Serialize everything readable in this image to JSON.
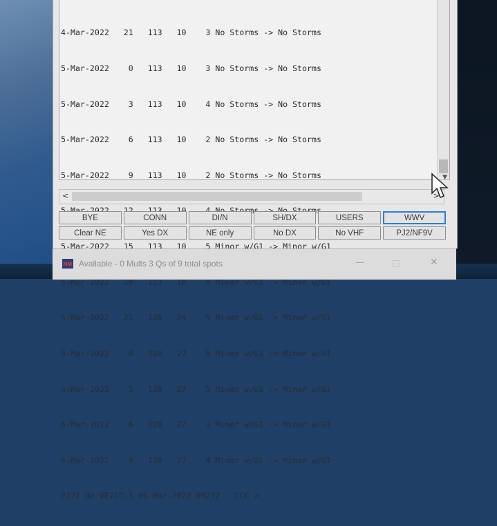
{
  "terminal": {
    "lines": [
      "4-Mar-2022   21   113   10    3 No Storms -> No Storms",
      "5-Mar-2022    0   113   10    3 No Storms -> No Storms",
      "5-Mar-2022    3   113   10    4 No Storms -> No Storms",
      "5-Mar-2022    6   113   10    2 No Storms -> No Storms",
      "5-Mar-2022    9   113   10    2 No Storms -> No Storms",
      "5-Mar-2022   12   113   10    4 No Storms -> No Storms",
      "5-Mar-2022   15   113   10    5 Minor w/G1 -> Minor w/G1",
      "5-Mar-2022   18   113   10    4 Minor w/G1 -> Minor w/G1",
      "5-Mar-2022   21   120   24    5 Minor w/G1 -> Minor w/G1",
      "6-Mar-2022    0   120   27    5 Minor w/G1 -> Minor w/G1",
      "6-Mar-2022    3   120   27    5 Minor w/G1 -> Minor w/G1",
      "6-Mar-2022    6   120   27    3 Minor w/G1 -> Minor w/G1",
      "6-Mar-2022    9   120   27    4 Minor w/G1 -> Minor w/G1",
      "PJ2T de VE7CC-1 06-Mar-2022 0923Z   CCC >"
    ]
  },
  "scroll": {
    "left": "<",
    "right": ">"
  },
  "buttons": {
    "row1": [
      "BYE",
      "CONN",
      "DI/N",
      "SH/DX",
      "USERS",
      "WWV"
    ],
    "row2": [
      "Clear NE",
      "Yes DX",
      "NE only",
      "No DX",
      "No VHF",
      "PJ2/NF9V"
    ]
  },
  "taskbar": {
    "icon_text": "NM",
    "title": "Available - 0 Mults 3 Qs of 9 total spots",
    "min": "—",
    "close": "✕"
  }
}
